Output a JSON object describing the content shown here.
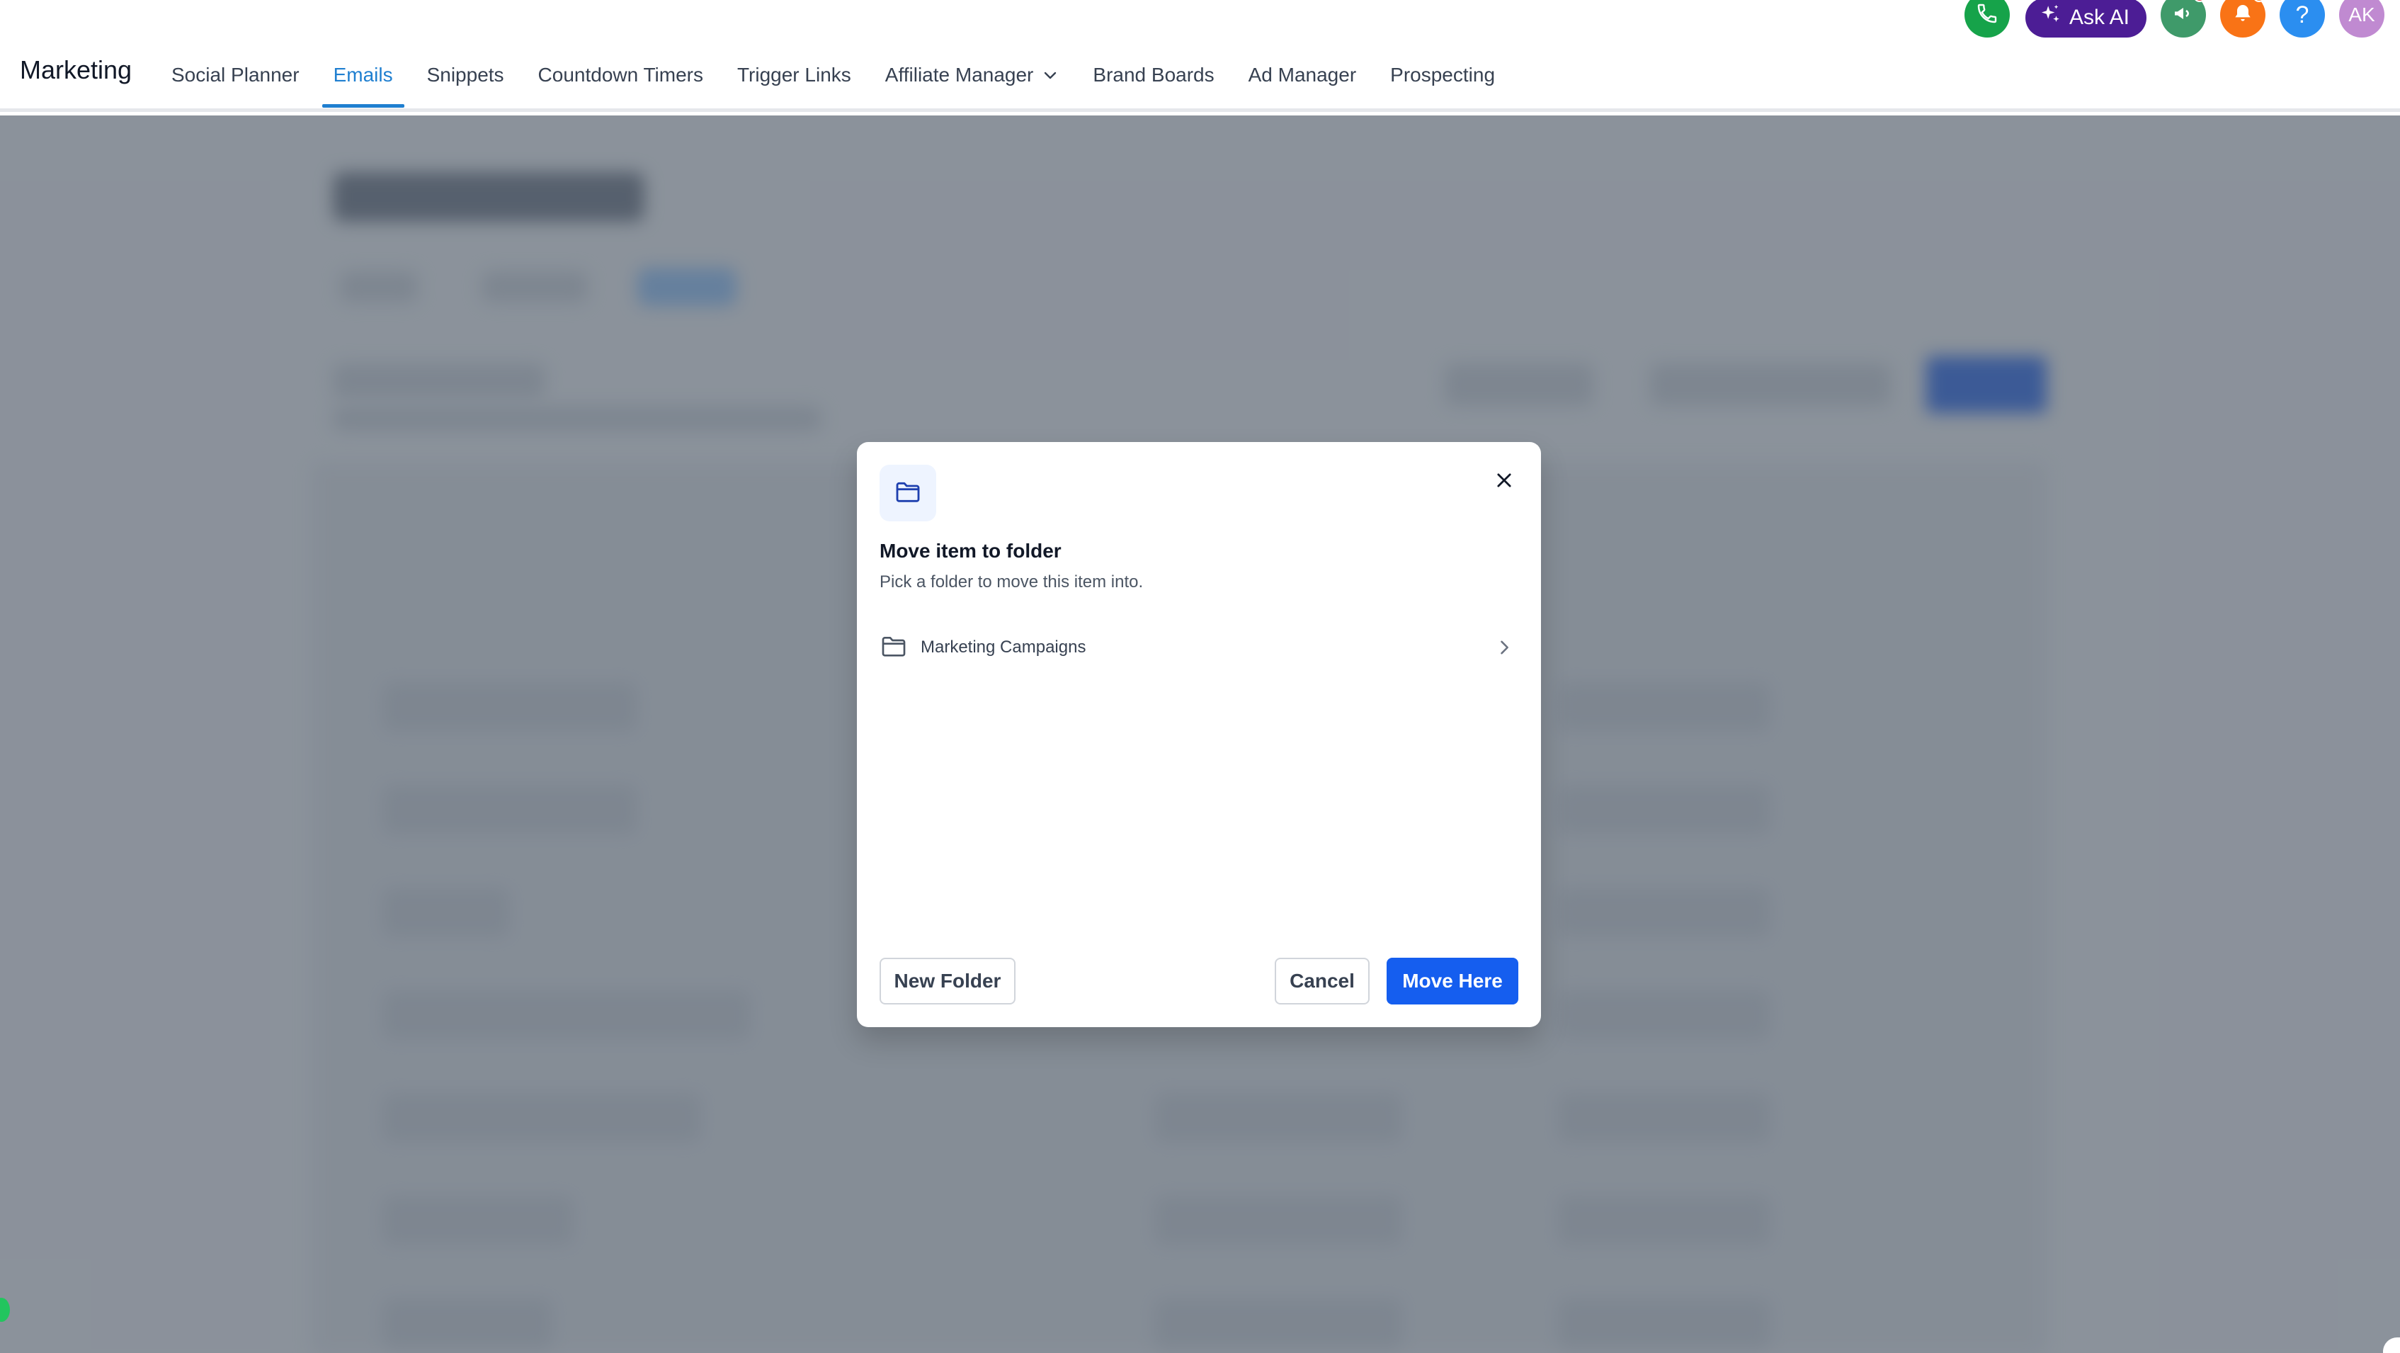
{
  "app": {
    "title": "Marketing"
  },
  "nav": {
    "items": [
      {
        "label": "Social Planner"
      },
      {
        "label": "Emails"
      },
      {
        "label": "Snippets"
      },
      {
        "label": "Countdown Timers"
      },
      {
        "label": "Trigger Links"
      },
      {
        "label": "Affiliate Manager"
      },
      {
        "label": "Brand Boards"
      },
      {
        "label": "Ad Manager"
      },
      {
        "label": "Prospecting"
      }
    ],
    "active": "Emails"
  },
  "header": {
    "ask_ai_label": "Ask AI",
    "help_label": "?",
    "avatar_initials": "AK",
    "icons": [
      "phone-icon",
      "sparkle-icon",
      "megaphone-icon",
      "bell-icon",
      "help-icon"
    ]
  },
  "modal": {
    "title": "Move item to folder",
    "subtitle": "Pick a folder to move this item into.",
    "folders": [
      {
        "label": "Marketing Campaigns"
      }
    ],
    "buttons": {
      "new_folder": "New Folder",
      "cancel": "Cancel",
      "move_here": "Move Here"
    }
  },
  "colors": {
    "accent": "#1f7fd0",
    "primary_button": "#155eef",
    "ask_ai": "#4c1d95",
    "phone": "#16a34a",
    "bell": "#f97316",
    "help": "#2b8ef0",
    "avatar": "#c08ad1",
    "overlay": "#4b5563"
  }
}
